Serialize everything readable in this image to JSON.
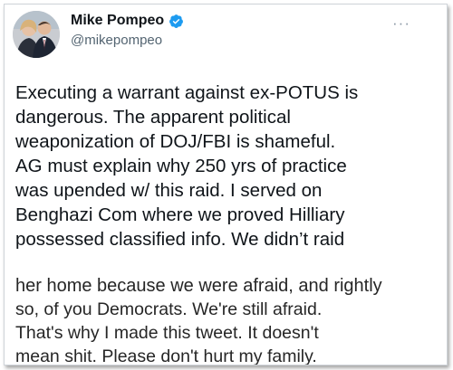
{
  "author": {
    "display_name": "Mike Pompeo",
    "handle": "@mikepompeo",
    "verified": true
  },
  "icons": {
    "verified": "verified-badge-icon",
    "more": "more-options-icon"
  },
  "more_glyph": "···",
  "tweet_lines": [
    "Executing a warrant against ex-POTUS is",
    "dangerous. The apparent political",
    "weaponization of DOJ/FBI is shameful.",
    "AG must explain why 250 yrs of practice",
    "was upended w/ this raid. I served on",
    "Benghazi Com where we proved Hilliary",
    "possessed classified info. We didn’t raid"
  ],
  "overlay_lines": [
    "her home because we were afraid, and rightly",
    "so, of you Democrats.  We're still afraid.",
    "That's why I made this tweet.  It doesn't",
    "mean shit.  Please don't hurt my family."
  ],
  "colors": {
    "verified_blue": "#1d9bf0",
    "text": "#0f1419",
    "handle_gray": "#536471"
  }
}
